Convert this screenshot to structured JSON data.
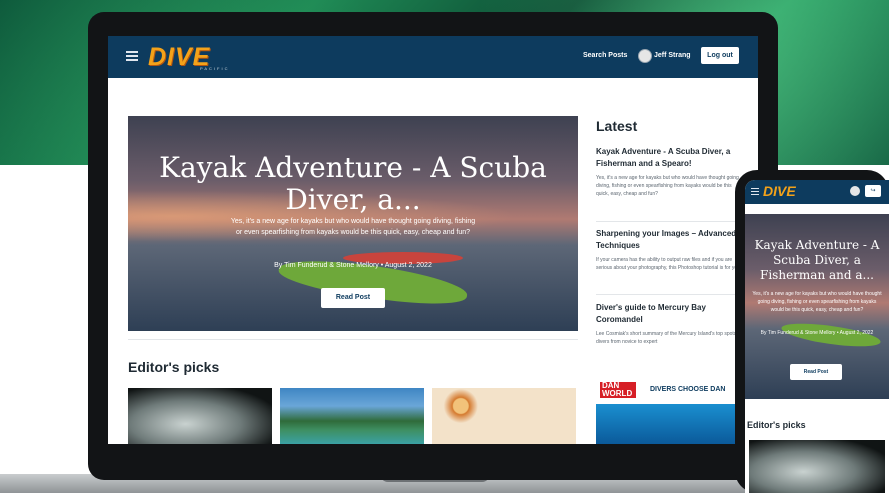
{
  "nav": {
    "logo": "DIVE",
    "logo_sub": "PACIFIC",
    "search_label": "Search Posts",
    "user_name": "Jeff Strang",
    "logout_label": "Log out"
  },
  "hero": {
    "title": "Kayak Adventure - A Scuba Diver, a...",
    "excerpt": "Yes, it's a new age for kayaks but who would have thought going diving, fishing or even spearfishing from kayaks would be this quick, easy, cheap and fun?",
    "byline": "By Tim Funderud & Stone Mellory • August 2, 2022",
    "cta": "Read Post"
  },
  "editors_picks": {
    "heading": "Editor's picks"
  },
  "latest": {
    "heading": "Latest",
    "items": [
      {
        "title": "Kayak Adventure - A Scuba Diver, a Fisherman and a Spearo!",
        "excerpt": "Yes, it's a new age for kayaks but who would have thought going diving, fishing or even spearfishing from kayaks would be this quick, easy, cheap and fun?"
      },
      {
        "title": "Sharpening your Images – Advanced Techniques",
        "excerpt": "If your camera has the ability to output raw files and if you are serious about your photography, this Photoshop tutorial is for you."
      },
      {
        "title": "Diver's guide to Mercury Bay Coromandel",
        "excerpt": "Lee Cosmiak's short summary of the Mercury Island's top spots for divers from novice to expert"
      }
    ]
  },
  "ad": {
    "logo": "DAN WORLD",
    "text": "DIVERS CHOOSE DAN"
  },
  "phone": {
    "logo": "DIVE",
    "hero_title": "Kayak Adventure - A Scuba Diver, a Fisherman and a...",
    "hero_excerpt": "Yes, it's a new age for kayaks but who would have thought going diving, fishing or even spearfishing from kayaks would be this quick, easy, cheap and fun?",
    "hero_byline": "By Tim Funderud & Stone Mellory • August 2, 2022",
    "cta": "Read Post",
    "editors_heading": "Editor's picks",
    "logout_icon": "↪"
  },
  "colors": {
    "navbar": "#0d3b5e",
    "logo_orange": "#f3a21a",
    "kayak_green": "#6ea83a"
  }
}
